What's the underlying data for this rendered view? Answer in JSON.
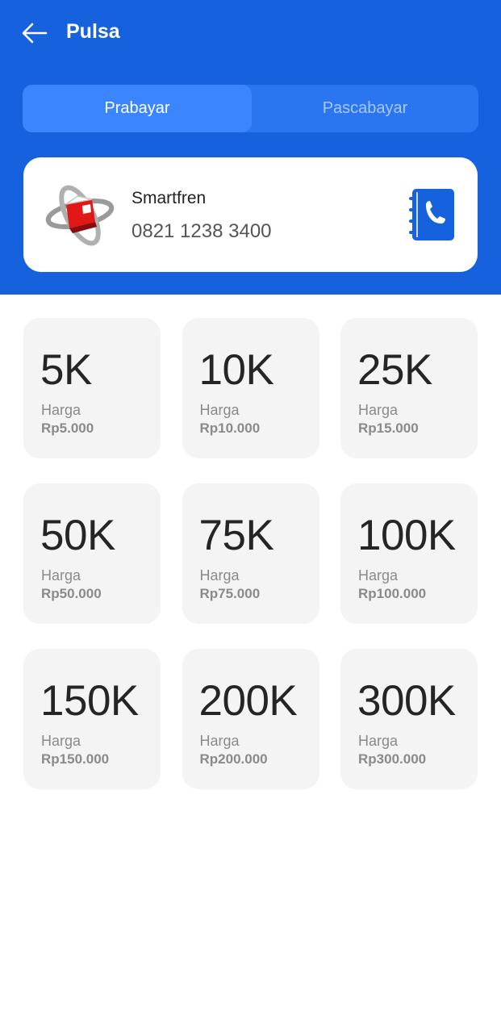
{
  "header": {
    "title": "Pulsa",
    "background_color": "#1661de",
    "back_icon": "arrow-left-icon"
  },
  "tabs": [
    {
      "label": "Prabayar",
      "active": true
    },
    {
      "label": "Pascabayar",
      "active": false
    }
  ],
  "provider": {
    "name": "Smartfren",
    "phone": "0821 1238 3400",
    "logo_icon": "provider-logo-icon",
    "contact_icon": "phone-book-icon",
    "accent_color": "#1661de"
  },
  "nominals": [
    {
      "value": "5K",
      "price_label": "Harga",
      "price": "Rp5.000"
    },
    {
      "value": "10K",
      "price_label": "Harga",
      "price": "Rp10.000"
    },
    {
      "value": "25K",
      "price_label": "Harga",
      "price": "Rp15.000"
    },
    {
      "value": "50K",
      "price_label": "Harga",
      "price": "Rp50.000"
    },
    {
      "value": "75K",
      "price_label": "Harga",
      "price": "Rp75.000"
    },
    {
      "value": "100K",
      "price_label": "Harga",
      "price": "Rp100.000"
    },
    {
      "value": "150K",
      "price_label": "Harga",
      "price": "Rp150.000"
    },
    {
      "value": "200K",
      "price_label": "Harga",
      "price": "Rp200.000"
    },
    {
      "value": "300K",
      "price_label": "Harga",
      "price": "Rp300.000"
    }
  ]
}
